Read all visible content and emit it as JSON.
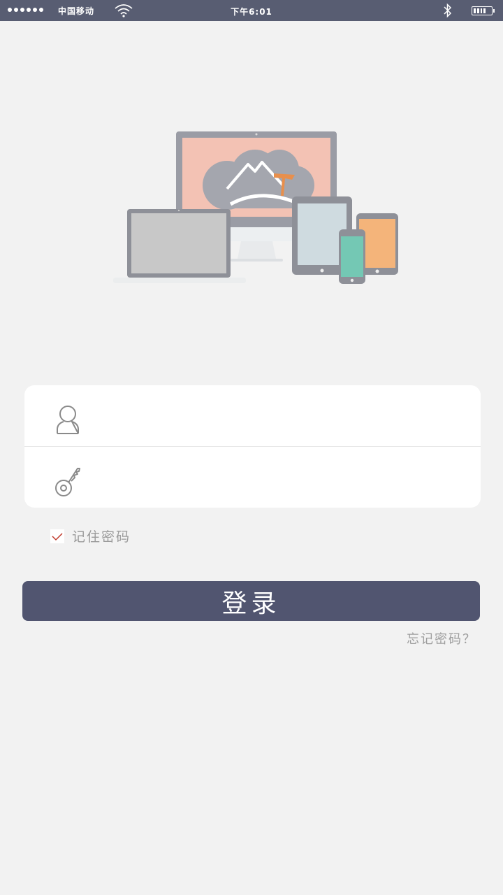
{
  "status_bar": {
    "carrier": "中国移动",
    "time": "下午6:01"
  },
  "login_form": {
    "username_placeholder": "",
    "password_placeholder": "",
    "remember_label": "记住密码",
    "remember_checked": true,
    "login_button_label": "登录",
    "forgot_password_label": "忘记密码？"
  },
  "colors": {
    "status_bar_bg": "#585d72",
    "button_bg": "#515570",
    "page_bg": "#f2f2f2",
    "check_mark": "#c0392b"
  },
  "icons": [
    "signal-dots-icon",
    "wifi-icon",
    "bluetooth-icon",
    "battery-icon",
    "user-icon",
    "key-icon",
    "check-icon"
  ]
}
